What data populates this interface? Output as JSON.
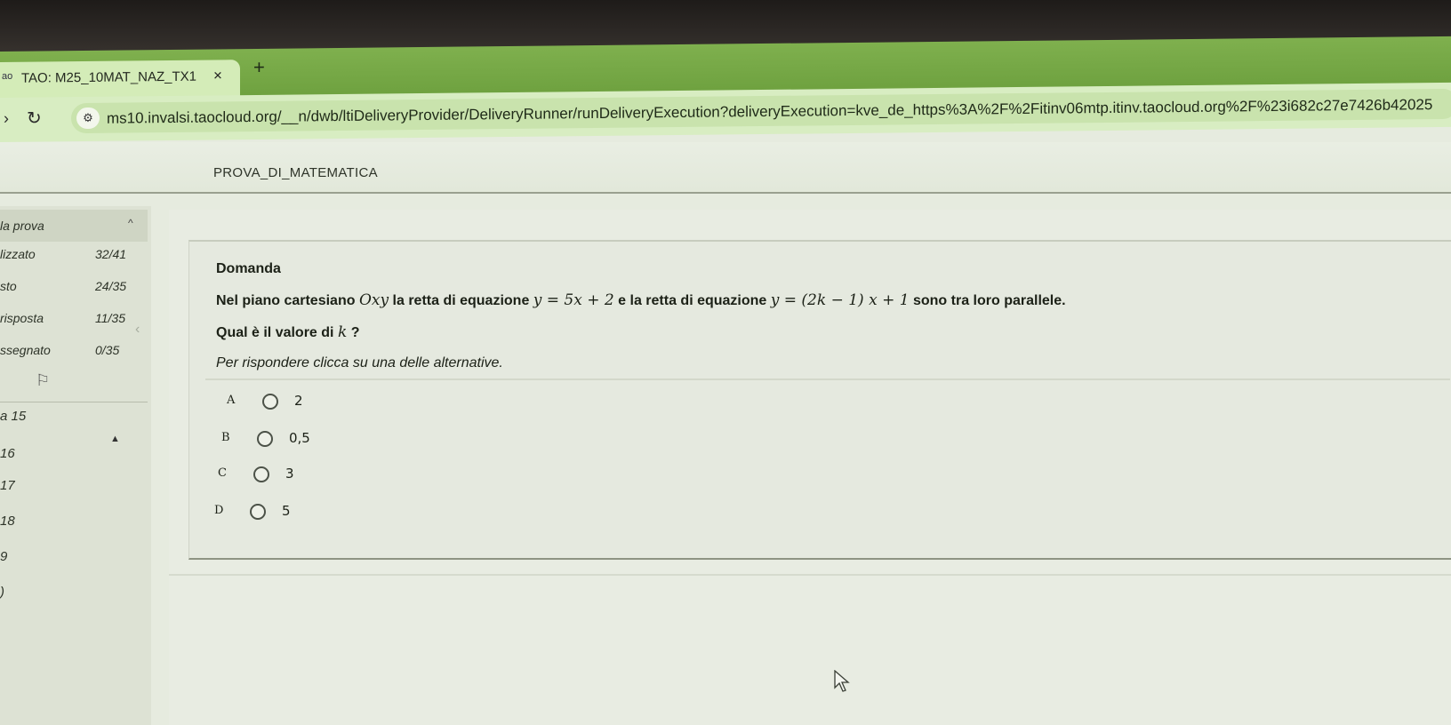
{
  "browser": {
    "tab_favicon": "ao",
    "tab_title": "TAO: M25_10MAT_NAZ_TX1",
    "tab_close": "×",
    "new_tab": "+",
    "url": "ms10.invalsi.taocloud.org/__n/dwb/ltiDeliveryProvider/DeliveryRunner/runDeliveryExecution?deliveryExecution=kve_de_https%3A%2F%2Fitinv06mtp.itinv.taocloud.org%2F%23i682c27e7426b42025"
  },
  "header": {
    "test_title": "PROVA_DI_MATEMATICA"
  },
  "sidebar": {
    "section_label": "la prova",
    "stats": [
      {
        "label": "lizzato",
        "count": "32/41"
      },
      {
        "label": "sto",
        "count": "24/35"
      },
      {
        "label": "risposta",
        "count": "11/35"
      },
      {
        "label": "ssegnato",
        "count": "0/35"
      }
    ],
    "items": [
      "a 15",
      "16",
      "17",
      "18",
      "9",
      ")"
    ]
  },
  "question": {
    "heading": "Domanda",
    "line1_a": "Nel piano cartesiano ",
    "line1_m1": "Oxy",
    "line1_b": "  la retta di equazione ",
    "line1_m2": "y = 5x + 2",
    "line1_c": " e la retta di equazione ",
    "line1_m3": "y = (2k − 1) x + 1",
    "line1_d": " sono tra loro parallele.",
    "line2_a": "Qual è il valore di ",
    "line2_m": "k",
    "line2_b": " ?",
    "instruction": "Per rispondere clicca su una delle alternative.",
    "choices": [
      {
        "letter": "A",
        "value": "2"
      },
      {
        "letter": "B",
        "value": "0,5"
      },
      {
        "letter": "C",
        "value": "3"
      },
      {
        "letter": "D",
        "value": "5"
      }
    ]
  },
  "icons": {
    "flag": "flag-icon",
    "chevron": "chevron-up-icon",
    "collapse": "chevron-left-icon",
    "cursor": "mouse-pointer-icon"
  }
}
